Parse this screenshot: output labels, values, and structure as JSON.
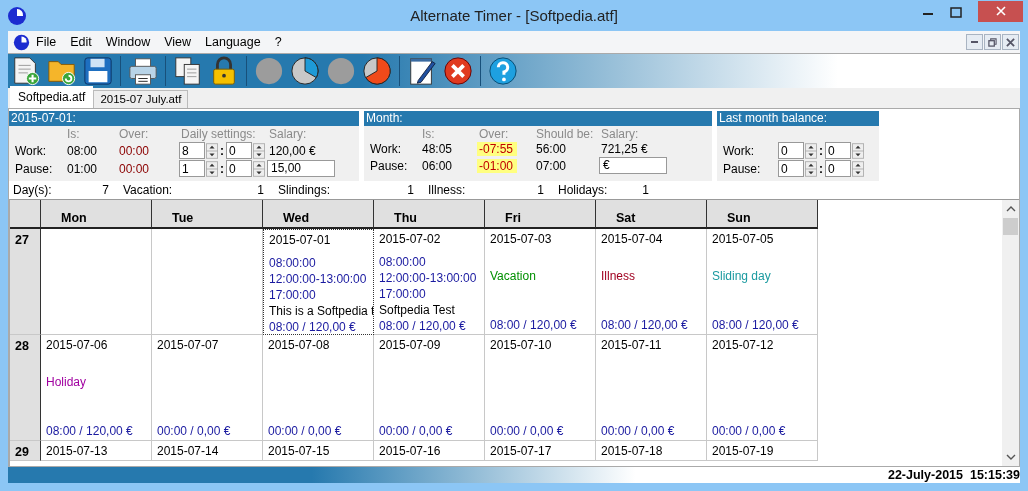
{
  "window": {
    "title": "Alternate Timer - [Softpedia.atf]"
  },
  "menu": [
    "File",
    "Edit",
    "Window",
    "View",
    "Language",
    "?"
  ],
  "toolbar": [
    {
      "kind": "new"
    },
    {
      "kind": "open"
    },
    {
      "kind": "save"
    },
    {
      "kind": "sep"
    },
    {
      "kind": "print"
    },
    {
      "kind": "sep"
    },
    {
      "kind": "copy"
    },
    {
      "kind": "lock"
    },
    {
      "kind": "sep"
    },
    {
      "kind": "disc"
    },
    {
      "kind": "pie-blue"
    },
    {
      "kind": "disc"
    },
    {
      "kind": "pie-red"
    },
    {
      "kind": "sep"
    },
    {
      "kind": "notes"
    },
    {
      "kind": "delete"
    },
    {
      "kind": "sep"
    },
    {
      "kind": "help"
    }
  ],
  "tabs": [
    {
      "label": "Softpedia.atf",
      "selected": true
    },
    {
      "label": "2015-07 July.atf",
      "selected": false
    }
  ],
  "day_panel": {
    "title": "2015-07-01:",
    "columns": [
      "Is:",
      "Over:",
      "Daily settings:",
      "Salary:"
    ],
    "rows": [
      {
        "label": "Work:",
        "is": "08:00",
        "over": "00:00",
        "hours": "8",
        "separator": ":",
        "minutes": "0",
        "salary": "120,00 €",
        "salary_is_field": false
      },
      {
        "label": "Pause:",
        "is": "01:00",
        "over": "00:00",
        "hours": "1",
        "separator": ":",
        "minutes": "0",
        "salary": "15,00",
        "salary_is_field": true
      }
    ]
  },
  "month_panel": {
    "title": "Month:",
    "columns": [
      "Is:",
      "Over:",
      "Should be:",
      "Salary:"
    ],
    "rows": [
      {
        "label": "Work:",
        "is": "48:05",
        "over": "-07:55",
        "over_highlighted": true,
        "should_be": "56:00",
        "salary": "721,25 €",
        "salary_is_field": false
      },
      {
        "label": "Pause:",
        "is": "06:00",
        "over": "-01:00",
        "over_highlighted": true,
        "should_be": "07:00",
        "salary": "€",
        "salary_is_field": true
      }
    ]
  },
  "last_month_panel": {
    "title": "Last month balance:",
    "rows": [
      {
        "label": "Work:",
        "hours": "0",
        "separator": ":",
        "minutes": "0"
      },
      {
        "label": "Pause:",
        "hours": "0",
        "separator": ":",
        "minutes": "0"
      }
    ]
  },
  "summary": [
    {
      "label": "Day(s):",
      "value": "7"
    },
    {
      "label": "Vacation:",
      "value": "1"
    },
    {
      "label": "Slindings:",
      "value": "1"
    },
    {
      "label": "Illness:",
      "value": "1"
    },
    {
      "label": "Holidays:",
      "value": "1"
    }
  ],
  "calendar": {
    "columns": [
      "Mon",
      "Tue",
      "Wed",
      "Thu",
      "Fri",
      "Sat",
      "Sun"
    ],
    "weeks": [
      {
        "number": "27",
        "days": [
          {
            "kind": "empty",
            "selected": false
          },
          {
            "kind": "empty",
            "selected": false
          },
          {
            "kind": "entry",
            "date": "2015-07-01",
            "times": [
              "08:00:00",
              "12:00:00-13:00:00",
              "17:00:00"
            ],
            "note": "This is a Softpedia t",
            "total": "08:00 / 120,00 €",
            "selected": true
          },
          {
            "kind": "entry",
            "date": "2015-07-02",
            "times": [
              "08:00:00",
              "12:00:00-13:00:00",
              "17:00:00"
            ],
            "note": "Softpedia Test",
            "total": "08:00 / 120,00 €",
            "selected": false
          },
          {
            "kind": "status",
            "date": "2015-07-03",
            "status": "Vacation",
            "color": "#009000",
            "total": "08:00 / 120,00 €",
            "selected": false
          },
          {
            "kind": "status",
            "date": "2015-07-04",
            "status": "Illness",
            "color": "#a00020",
            "total": "08:00 / 120,00 €",
            "selected": false
          },
          {
            "kind": "status",
            "date": "2015-07-05",
            "status": "Sliding day",
            "color": "#1a9aa0",
            "total": "08:00 / 120,00 €",
            "selected": false
          }
        ]
      },
      {
        "number": "28",
        "days": [
          {
            "kind": "status",
            "date": "2015-07-06",
            "status": "Holiday",
            "color": "#a000a0",
            "total": "08:00 / 120,00 €",
            "selected": false
          },
          {
            "kind": "plain",
            "date": "2015-07-07",
            "total": "00:00 / 0,00 €",
            "selected": false
          },
          {
            "kind": "plain",
            "date": "2015-07-08",
            "total": "00:00 / 0,00 €",
            "selected": false
          },
          {
            "kind": "plain",
            "date": "2015-07-09",
            "total": "00:00 / 0,00 €",
            "selected": false
          },
          {
            "kind": "plain",
            "date": "2015-07-10",
            "total": "00:00 / 0,00 €",
            "selected": false
          },
          {
            "kind": "plain",
            "date": "2015-07-11",
            "total": "00:00 / 0,00 €",
            "selected": false
          },
          {
            "kind": "plain",
            "date": "2015-07-12",
            "total": "00:00 / 0,00 €",
            "selected": false
          }
        ]
      },
      {
        "number": "29",
        "days": [
          {
            "kind": "date",
            "date": "2015-07-13",
            "selected": false
          },
          {
            "kind": "date",
            "date": "2015-07-14",
            "selected": false
          },
          {
            "kind": "date",
            "date": "2015-07-15",
            "selected": false
          },
          {
            "kind": "date",
            "date": "2015-07-16",
            "selected": false
          },
          {
            "kind": "date",
            "date": "2015-07-17",
            "selected": false
          },
          {
            "kind": "date",
            "date": "2015-07-18",
            "selected": false
          },
          {
            "kind": "date",
            "date": "2015-07-19",
            "selected": false
          }
        ]
      }
    ]
  },
  "status_bar": {
    "datetime": "22-July-2015  15:15:39"
  }
}
